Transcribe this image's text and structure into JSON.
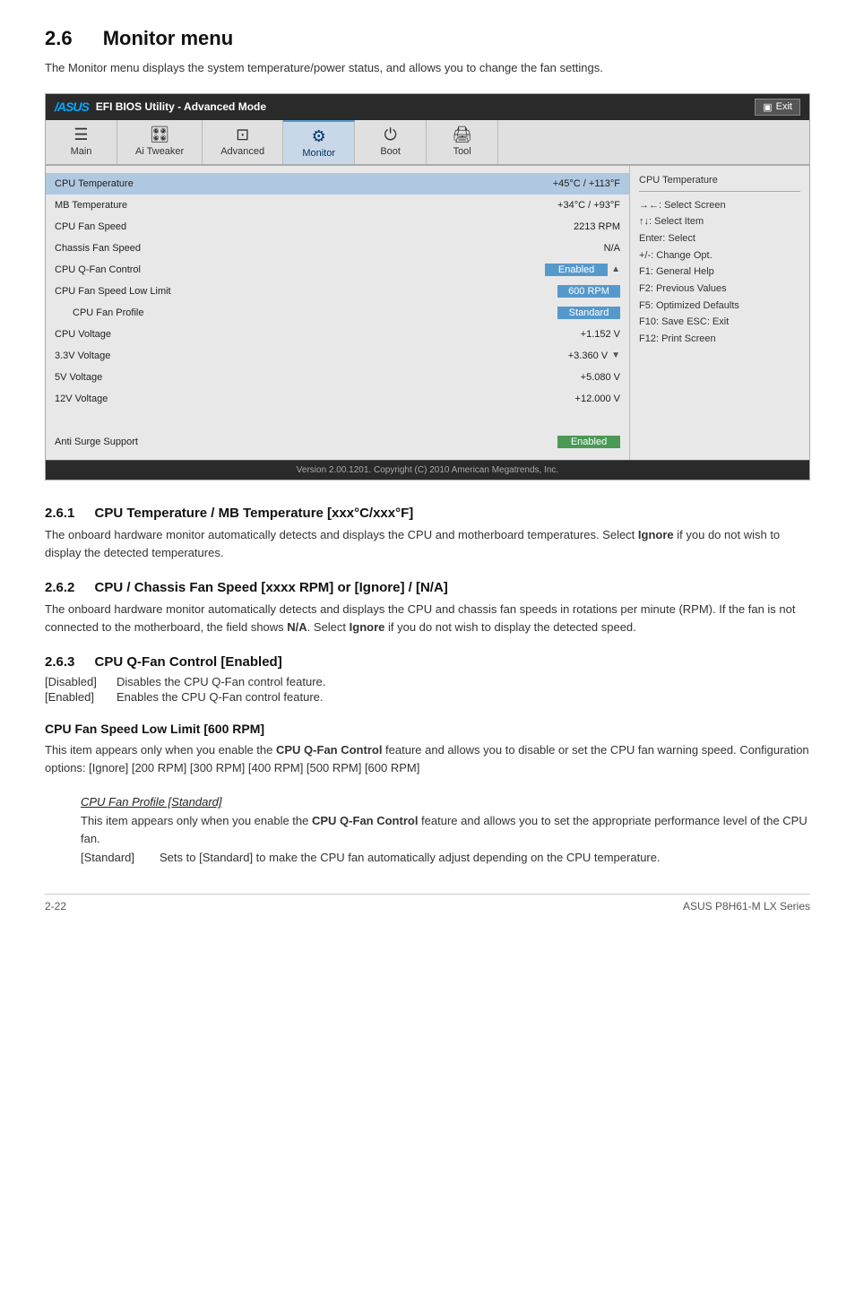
{
  "page": {
    "section": "2.6",
    "title": "Monitor menu",
    "intro": "The Monitor menu displays the system temperature/power status, and allows you to change the fan settings."
  },
  "bios": {
    "titlebar": {
      "logo": "/ASUS",
      "title": "EFI BIOS Utility - Advanced Mode",
      "exit_label": "Exit"
    },
    "tabs": [
      {
        "label": "Main",
        "icon": "≡≡",
        "active": false
      },
      {
        "label": "Ai Tweaker",
        "icon": "🔧",
        "active": false
      },
      {
        "label": "Advanced",
        "icon": "⊡",
        "active": false
      },
      {
        "label": "Monitor",
        "icon": "⚙",
        "active": true
      },
      {
        "label": "Boot",
        "icon": "⏻",
        "active": false
      },
      {
        "label": "Tool",
        "icon": "🖨",
        "active": false
      }
    ],
    "rows": [
      {
        "label": "CPU Temperature",
        "value": "+45°C / +113°F",
        "type": "highlighted",
        "badge": false
      },
      {
        "label": "MB Temperature",
        "value": "+34°C / +93°F",
        "type": "normal",
        "badge": false
      },
      {
        "label": "CPU Fan Speed",
        "value": "2213 RPM",
        "type": "normal",
        "badge": false
      },
      {
        "label": "Chassis Fan Speed",
        "value": "N/A",
        "type": "normal",
        "badge": false
      },
      {
        "label": "CPU Q-Fan Control",
        "value": "Enabled",
        "type": "normal",
        "badge": true,
        "badge_color": "blue",
        "scroll": "up"
      },
      {
        "label": "CPU Fan Speed Low Limit",
        "value": "600 RPM",
        "type": "normal",
        "badge": true,
        "badge_color": "blue"
      },
      {
        "label": "CPU Fan Profile",
        "value": "Standard",
        "type": "normal",
        "badge": true,
        "badge_color": "blue",
        "indented": true
      },
      {
        "label": "CPU Voltage",
        "value": "+1.152 V",
        "type": "normal",
        "badge": false
      },
      {
        "label": "3.3V Voltage",
        "value": "+3.360 V",
        "type": "normal",
        "badge": false,
        "scroll": "down"
      },
      {
        "label": "5V Voltage",
        "value": "+5.080 V",
        "type": "normal",
        "badge": false
      },
      {
        "label": "12V Voltage",
        "value": "+12.000 V",
        "type": "normal",
        "badge": false
      },
      {
        "label": "",
        "value": "",
        "type": "spacer",
        "badge": false
      },
      {
        "label": "Anti Surge Support",
        "value": "Enabled",
        "type": "normal",
        "badge": true,
        "badge_color": "green"
      }
    ],
    "right_panel": {
      "title": "CPU Temperature",
      "shortcuts": [
        "→←: Select Screen",
        "↑↓: Select Item",
        "Enter: Select",
        "+/-: Change Opt.",
        "F1: General Help",
        "F2: Previous Values",
        "F5: Optimized Defaults",
        "F10: Save  ESC: Exit",
        "F12: Print Screen"
      ]
    },
    "footer": "Version 2.00.1201.  Copyright (C) 2010 American Megatrends, Inc."
  },
  "subsections": [
    {
      "num": "2.6.1",
      "title": "CPU Temperature / MB Temperature [xxx°C/xxx°F]",
      "paragraphs": [
        "The onboard hardware monitor automatically detects and displays the CPU and motherboard temperatures. Select <b>Ignore</b> if you do not wish to display the detected temperatures."
      ],
      "options": []
    },
    {
      "num": "2.6.2",
      "title": "CPU / Chassis Fan Speed [xxxx RPM] or [Ignore] / [N/A]",
      "paragraphs": [
        "The onboard hardware monitor automatically detects and displays the CPU and chassis fan speeds in rotations per minute (RPM). If the fan is not connected to the motherboard, the field shows <b>N/A</b>. Select <b>Ignore</b> if you do not wish to display the detected speed."
      ],
      "options": []
    },
    {
      "num": "2.6.3",
      "title": "CPU Q-Fan Control [Enabled]",
      "paragraphs": [],
      "options": [
        {
          "tag": "[Disabled]",
          "desc": "Disables the CPU Q-Fan control feature."
        },
        {
          "tag": "[Enabled]",
          "desc": "Enables the CPU Q-Fan control feature."
        }
      ]
    }
  ],
  "cpu_fan_speed_low_limit": {
    "heading": "CPU Fan Speed Low Limit [600 RPM]",
    "text": "This item appears only when you enable the <b>CPU Q-Fan Control</b> feature and allows you to disable or set the CPU fan warning speed. Configuration options: [Ignore] [200 RPM] [300 RPM] [400 RPM] [500 RPM] [600 RPM]"
  },
  "cpu_fan_profile": {
    "heading": "CPU Fan Profile [Standard]",
    "desc": "This item appears only when you enable the <b>CPU Q-Fan Control</b> feature and allows you to set the appropriate performance level of the CPU fan.",
    "options": [
      {
        "tag": "[Standard]",
        "desc": "Sets to [Standard] to make the CPU fan automatically adjust depending on the CPU temperature."
      }
    ]
  },
  "footer": {
    "page_num": "2-22",
    "product": "ASUS P8H61-M LX Series"
  }
}
